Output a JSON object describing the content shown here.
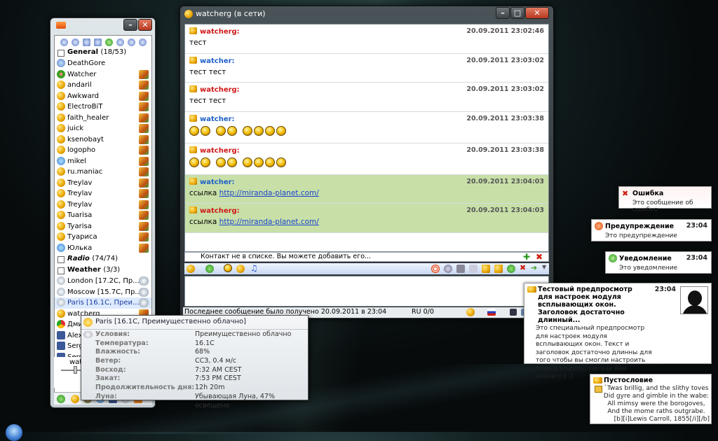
{
  "colors": {
    "accent_red": "#d01818",
    "accent_blue": "#1e5fc8",
    "link": "#1a44cc",
    "green_msg": "#c8e0a8"
  },
  "contact_list": {
    "toolbar_icons": [
      "menu-icon",
      "users-icon",
      "options-icon",
      "list-icon",
      "status-icon",
      "gear-icon",
      "sound-icon",
      "minus-icon"
    ],
    "groups": [
      {
        "name": "General",
        "count": "(18/53)",
        "contacts": [
          {
            "name": "DeathGore",
            "icon": "pidgin-icon"
          },
          {
            "name": "Watcher",
            "icon": "icq-flower-icon"
          },
          {
            "name": "andaril",
            "icon": "jabber-bulb-icon"
          },
          {
            "name": "Awkward",
            "icon": "jabber-bulb-icon"
          },
          {
            "name": "ElectroBiT",
            "icon": "jabber-bulb-icon"
          },
          {
            "name": "faith_healer",
            "icon": "jabber-bulb-icon"
          },
          {
            "name": "juick",
            "icon": "jabber-bulb-icon"
          },
          {
            "name": "ksenobayt",
            "icon": "jabber-bulb-icon"
          },
          {
            "name": "logopho",
            "icon": "jabber-bulb-icon"
          },
          {
            "name": "mikel",
            "icon": "globe-icon"
          },
          {
            "name": "ru.maniac",
            "icon": "jabber-bulb-icon"
          },
          {
            "name": "Treylav",
            "icon": "jabber-bulb-icon"
          },
          {
            "name": "Treylav",
            "icon": "jabber-bulb-icon"
          },
          {
            "name": "Treylav",
            "icon": "jabber-bulb-icon"
          },
          {
            "name": "Tuarisa",
            "icon": "jabber-bulb-icon"
          },
          {
            "name": "Tyarisa",
            "icon": "jabber-bulb-icon"
          },
          {
            "name": "Туарисa",
            "icon": "jabber-bulb-icon"
          },
          {
            "name": "Юлька",
            "icon": "globe-icon"
          }
        ]
      },
      {
        "name": "Radio",
        "count": "(74/74)",
        "contacts": []
      },
      {
        "name": "Weather",
        "count": "(3/3)",
        "contacts": [
          {
            "name": "London  [17.2C, Пр...",
            "icon": "weather-icon"
          },
          {
            "name": "Moscow  [15.7C, Пр...",
            "icon": "weather-icon"
          },
          {
            "name": "Paris  [16.1C, Преи...",
            "icon": "weather-icon"
          }
        ]
      }
    ],
    "extra_contacts": [
      {
        "name": "watcherg",
        "icon": "jabber-bulb-icon"
      },
      {
        "name": "Дми",
        "icon": "chrome-icon"
      },
      {
        "name": "Alex",
        "icon": "facebook-icon"
      },
      {
        "name": "Serg",
        "icon": "facebook-icon"
      },
      {
        "name": "Serg",
        "icon": "facebook-icon"
      }
    ],
    "volume_label": "watc"
  },
  "chat": {
    "title": "watcherg (в сети)",
    "messages": [
      {
        "name": "watcherg:",
        "time": "20.09.2011 23:02:46",
        "text": "тест",
        "color": "red",
        "green": false,
        "smileys": 0,
        "link": ""
      },
      {
        "name": "watcher:",
        "time": "20.09.2011 23:03:02",
        "text": "тест тест",
        "color": "blue",
        "green": false,
        "smileys": 0,
        "link": ""
      },
      {
        "name": "watcherg:",
        "time": "20.09.2011 23:03:02",
        "text": "тест тест",
        "color": "red",
        "green": false,
        "smileys": 0,
        "link": ""
      },
      {
        "name": "watcher:",
        "time": "20.09.2011 23:03:38",
        "text": "",
        "color": "blue",
        "green": false,
        "smileys": 8,
        "link": ""
      },
      {
        "name": "watcherg:",
        "time": "20.09.2011 23:03:38",
        "text": "",
        "color": "red",
        "green": false,
        "smileys": 8,
        "link": ""
      },
      {
        "name": "watcher:",
        "time": "20.09.2011 23:04:03",
        "text": "ссылка",
        "color": "blue",
        "green": true,
        "smileys": 0,
        "link": "http://miranda-planet.com/"
      },
      {
        "name": "watcherg:",
        "time": "20.09.2011 23:04:03",
        "text": "ссылка",
        "color": "red",
        "green": true,
        "smileys": 0,
        "link": "http://miranda-planet.com/"
      }
    ],
    "notice": "Контакт не в списке. Вы можете добавить его...",
    "status_left": "Последнее сообщение было получено 20.09.2011 в 23:04",
    "status_lang": "RU 0/0"
  },
  "tooltip": {
    "title": "Paris  [16.1C, Преимущественно облачно]",
    "rows": [
      {
        "k": "Условия:",
        "v": "Преимущественно облачно"
      },
      {
        "k": "Температура:",
        "v": "16.1C"
      },
      {
        "k": "Влажность:",
        "v": "68%"
      },
      {
        "k": "Ветер:",
        "v": "ССЗ, 0.4 м/с"
      },
      {
        "k": "Восход:",
        "v": "7:32 AM CEST"
      },
      {
        "k": "Закат:",
        "v": "7:53 PM CEST"
      },
      {
        "k": "Продолжительность дня:",
        "v": "12h 20m"
      },
      {
        "k": "Луна:",
        "v": "Убывающая Луна, 47% освещено"
      }
    ]
  },
  "popups": {
    "error": {
      "title": "Ошибка",
      "text": "Это сообщение об ошибке"
    },
    "warning": {
      "title": "Предупреждение",
      "time": "23:04",
      "text": "Это предупреждение"
    },
    "notify": {
      "title": "Уведомление",
      "time": "23:04",
      "text": "Это уведомление"
    },
    "preview": {
      "title": "Тестовый предпросмотр для настроек модуля всплывающих окон. Заголовок достаточно длинный...",
      "time": "23:04",
      "text": "Это специальный предпросмотр для настроек модуля всплывающих окон. Текст и заголовок достаточно длинны для того чтобы вы смогли настроить скин и модуль, так как вам нравится ;)"
    },
    "nonsense": {
      "title": "Пустословие",
      "lines": [
        "`Twas brillig, and the slithy toves",
        "Did gyre and gimble in the wabe:",
        "All mimsy were the borogoves,",
        "And the mome raths outgrabe.",
        "[b][i]Lewis Carroll, 1855[/i][/b]"
      ]
    }
  }
}
